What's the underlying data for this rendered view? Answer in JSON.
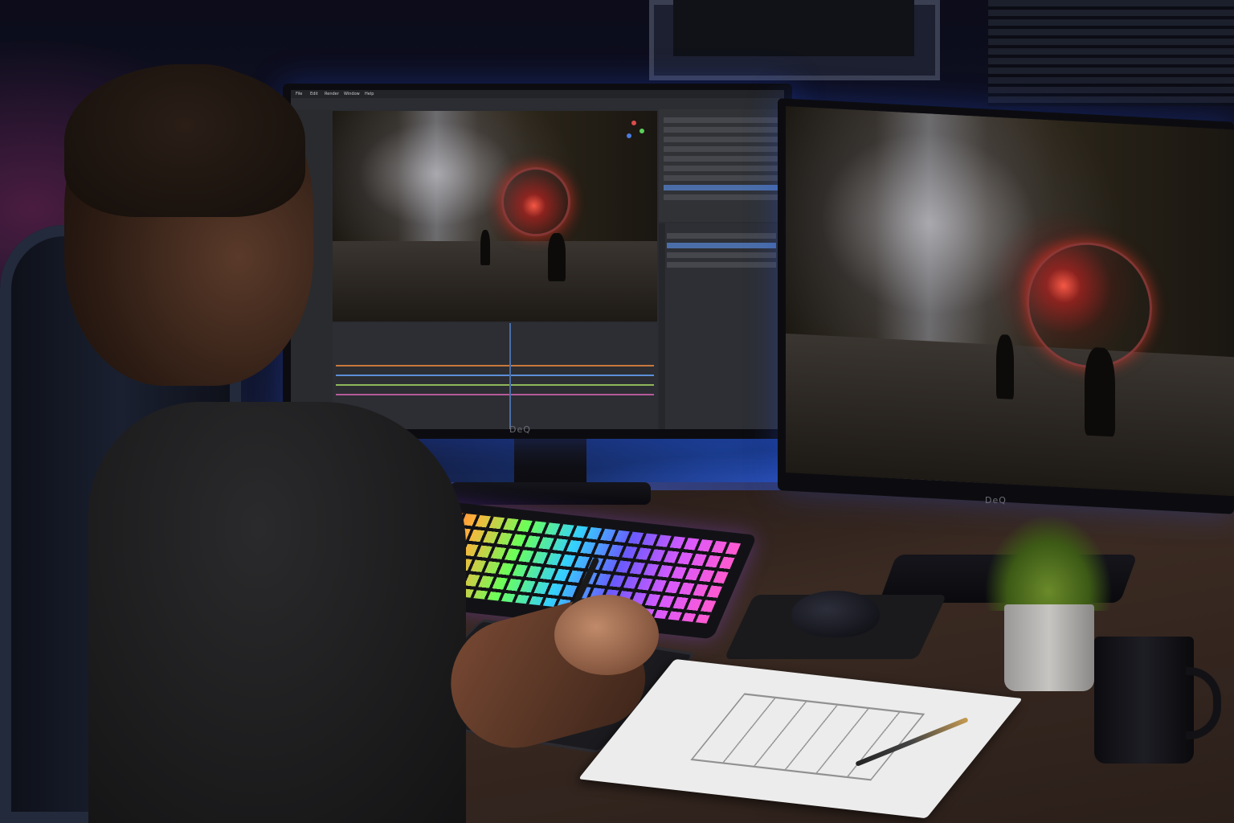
{
  "scene": {
    "description_tags": [
      "desk-setup",
      "dual-monitor",
      "3d-software"
    ],
    "colors": {
      "ambient_blue": "#3a58c8",
      "ambient_purple": "#4a1c40",
      "portal_red": "#ff4a3a",
      "ui_selection": "#4b6ea8"
    }
  },
  "monitors": {
    "left_brand": "DeQ",
    "right_brand": "DeQ"
  },
  "editor": {
    "menu_items": [
      "File",
      "Edit",
      "Render",
      "Window",
      "Help"
    ],
    "timeline_tracks": 4
  }
}
